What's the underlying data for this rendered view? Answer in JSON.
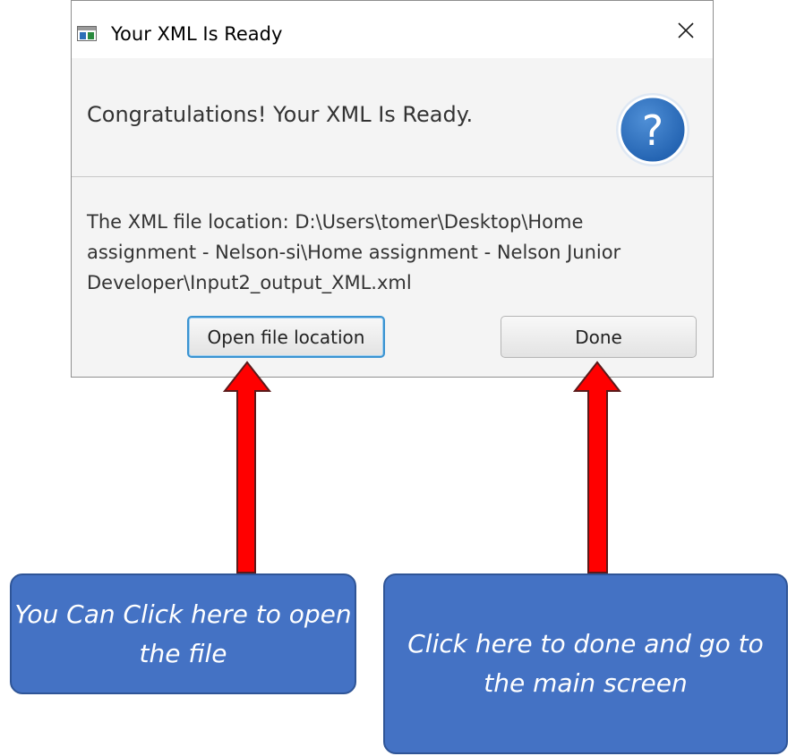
{
  "dialog": {
    "title": "Your XML Is Ready",
    "header": "Congratulations! Your XML Is Ready.",
    "content": "The XML file location: D:\\Users\\tomer\\Desktop\\Home assignment - Nelson-si\\Home assignment - Nelson Junior Developer\\Input2_output_XML.xml",
    "buttons": {
      "open_label": "Open file location",
      "done_label": "Done"
    },
    "icons": {
      "app": "app-window-icon",
      "close": "close-icon",
      "help": "question-mark-icon"
    },
    "colors": {
      "help_icon": "#1f5fae",
      "focus_border": "#3a93d1"
    }
  },
  "annotations": {
    "left_callout": "You Can Click here to open the file",
    "right_callout": "Click here to done and go to the main screen",
    "colors": {
      "arrow_fill": "#ff0000",
      "callout_fill": "#4472c4"
    }
  }
}
